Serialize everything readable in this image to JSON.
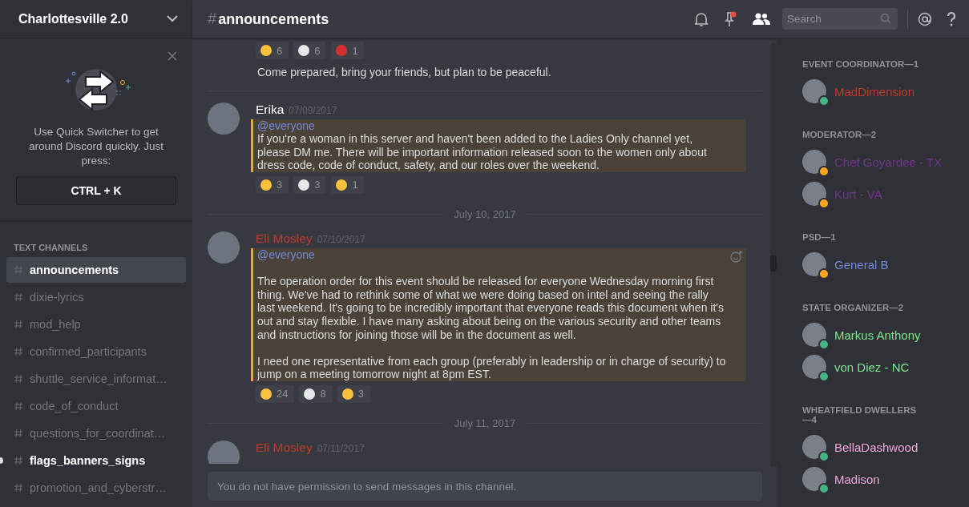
{
  "server": {
    "name": "Charlottesville 2.0"
  },
  "quick_switcher": {
    "text": "Use Quick Switcher to get around Discord quickly. Just press:",
    "shortcut": "CTRL + K"
  },
  "channel_section": "TEXT CHANNELS",
  "channels": [
    {
      "name": "announcements",
      "selected": true,
      "unread": false
    },
    {
      "name": "dixie-lyrics",
      "selected": false,
      "unread": false
    },
    {
      "name": "mod_help",
      "selected": false,
      "unread": false
    },
    {
      "name": "confirmed_participants",
      "selected": false,
      "unread": false
    },
    {
      "name": "shuttle_service_informat…",
      "selected": false,
      "unread": false
    },
    {
      "name": "code_of_conduct",
      "selected": false,
      "unread": false
    },
    {
      "name": "questions_for_coordinat…",
      "selected": false,
      "unread": false
    },
    {
      "name": "flags_banners_signs",
      "selected": false,
      "unread": true
    },
    {
      "name": "promotion_and_cyberstr…",
      "selected": false,
      "unread": false
    }
  ],
  "channel_header": {
    "hash": "#",
    "name": "announcements",
    "search_placeholder": "Search"
  },
  "feed": [
    {
      "kind": "continuation",
      "reactions": [
        {
          "count": "6"
        },
        {
          "count": "6"
        },
        {
          "count": "1"
        }
      ],
      "paragraphs": [
        "Come prepared, bring your friends, but plan to be peaceful."
      ]
    },
    {
      "kind": "separator"
    },
    {
      "kind": "message",
      "author": "Erika",
      "color": "#ffffff",
      "timestamp": "07/09/2017",
      "highlighted": true,
      "mention": "@everyone",
      "paragraphs": [
        "If you're a woman in this server and haven't been added to the Ladies Only channel yet, please DM me. There will be important information released soon to the women only about dress code, code of conduct, safety, and our roles over the weekend."
      ],
      "reactions": [
        {
          "count": "3"
        },
        {
          "count": "3"
        },
        {
          "count": "1"
        }
      ]
    },
    {
      "kind": "date",
      "label": "July 10, 2017"
    },
    {
      "kind": "message",
      "author": "Eli Mosley",
      "color": "#c0392b",
      "timestamp": "07/10/2017",
      "highlighted": true,
      "mention": "@everyone",
      "paragraphs": [
        "The operation order for this event should be released for everyone Wednesday morning first thing. We've had to rethink some of what we were doing based on intel and seeing the rally last weekend. It's going to be incredibly important that everyone reads this document when it's out and stay flexible. I have many asking about being on the various security and other teams and instructions for joining those will be in the document as well.",
        "I need one representative from each group (preferably in leadership or in charge of security) to jump on a meeting tomorrow night at 8pm EST."
      ],
      "reactions": [
        {
          "count": "24"
        },
        {
          "count": "8"
        },
        {
          "count": "3"
        }
      ]
    },
    {
      "kind": "date",
      "label": "July 11, 2017"
    },
    {
      "kind": "message",
      "author": "Eli Mosley",
      "color": "#c0392b",
      "timestamp": "07/11/2017"
    }
  ],
  "composer": {
    "placeholder": "You do not have permission to send messages in this channel."
  },
  "member_groups": [
    {
      "title": "EVENT COORDINATOR—1",
      "color": "#c0392b",
      "members": [
        {
          "name": "MadDimension",
          "color": "#43b581"
        }
      ]
    },
    {
      "title": "MODERATOR—2",
      "color": "#71368a",
      "members": [
        {
          "name": "Chef Goyardee - TX",
          "color": "#faa61a"
        },
        {
          "name": "Kurt - VA",
          "color": "#faa61a"
        }
      ]
    },
    {
      "title": "PSD—1",
      "color": "#7289da",
      "members": [
        {
          "name": "General B",
          "color": "#faa61a"
        }
      ]
    },
    {
      "title": "STATE ORGANIZER—2",
      "color": "#7ce88c",
      "members": [
        {
          "name": "Markus Anthony",
          "color": "#43b581"
        },
        {
          "name": "von Diez - NC",
          "color": "#43b581"
        }
      ]
    },
    {
      "title": "WHEATFIELD DWELLERS—4",
      "color": "#f0a6d8",
      "members": [
        {
          "name": "BellaDashwood",
          "color": "#43b581"
        },
        {
          "name": "Madison",
          "color": "#43b581"
        }
      ]
    }
  ]
}
